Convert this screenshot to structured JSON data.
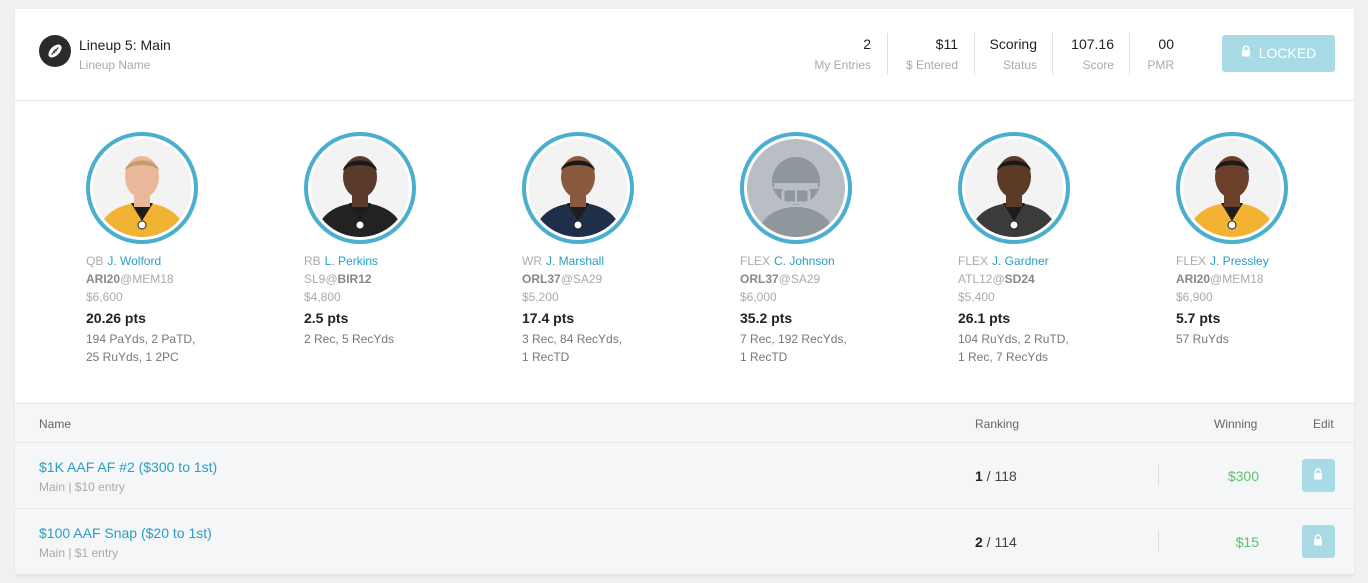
{
  "header": {
    "lineup_title": "Lineup 5: Main",
    "lineup_sub": "Lineup Name",
    "stats": [
      {
        "value": "2",
        "label": "My Entries"
      },
      {
        "value": "$11",
        "label": "$ Entered"
      },
      {
        "value": "Scoring",
        "label": "Status"
      },
      {
        "value": "107.16",
        "label": "Score"
      },
      {
        "value": "00",
        "label": "PMR"
      }
    ],
    "locked_label": "LOCKED"
  },
  "players": [
    {
      "pos": "QB",
      "name": "J. Wolford",
      "team": "ARI20",
      "opp": "MEM18",
      "bold": "team",
      "salary": "$6,600",
      "pts": "20.26 pts",
      "stats1": "194 PaYds, 2 PaTD,",
      "stats2": "25 RuYds, 1 2PC",
      "jersey": "#f2b233",
      "skin": "#e9b89a",
      "hair": "#c89b6a"
    },
    {
      "pos": "RB",
      "name": "L. Perkins",
      "team": "SL9",
      "opp": "BIR12",
      "bold": "opp",
      "salary": "$4,800",
      "pts": "2.5 pts",
      "stats1": "2 Rec, 5 RecYds",
      "stats2": "",
      "jersey": "#222222",
      "skin": "#5a3a2a",
      "hair": "#1a1a1a"
    },
    {
      "pos": "WR",
      "name": "J. Marshall",
      "team": "ORL37",
      "opp": "SA29",
      "bold": "team",
      "salary": "$5,200",
      "pts": "17.4 pts",
      "stats1": "3 Rec, 84 RecYds,",
      "stats2": "1 RecTD",
      "jersey": "#1f2f4a",
      "skin": "#8a5a3e",
      "hair": "#1a1a1a"
    },
    {
      "pos": "FLEX",
      "name": "C. Johnson",
      "team": "ORL37",
      "opp": "SA29",
      "bold": "team",
      "salary": "$6,000",
      "pts": "35.2 pts",
      "stats1": "7 Rec, 192 RecYds,",
      "stats2": "1 RecTD",
      "jersey": "",
      "skin": "",
      "hair": ""
    },
    {
      "pos": "FLEX",
      "name": "J. Gardner",
      "team": "ATL12",
      "opp": "SD24",
      "bold": "opp",
      "salary": "$5,400",
      "pts": "26.1 pts",
      "stats1": "104 RuYds, 2 RuTD,",
      "stats2": "1 Rec, 7 RecYds",
      "jersey": "#3b3b3b",
      "skin": "#5c3a28",
      "hair": "#1a1a1a"
    },
    {
      "pos": "FLEX",
      "name": "J. Pressley",
      "team": "ARI20",
      "opp": "MEM18",
      "bold": "team",
      "salary": "$6,900",
      "pts": "5.7 pts",
      "stats1": "57 RuYds",
      "stats2": "",
      "jersey": "#f2b233",
      "skin": "#6b3f2a",
      "hair": "#1a1a1a"
    }
  ],
  "table": {
    "headers": {
      "name": "Name",
      "ranking": "Ranking",
      "winning": "Winning",
      "edit": "Edit"
    },
    "rows": [
      {
        "title": "$1K AAF AF #2 ($300 to 1st)",
        "sub": "Main | $10 entry",
        "rank": "1",
        "total": "118",
        "win": "$300"
      },
      {
        "title": "$100 AAF Snap ($20 to 1st)",
        "sub": "Main | $1 entry",
        "rank": "2",
        "total": "114",
        "win": "$15"
      }
    ]
  },
  "colors": {
    "accent": "#4aaecf",
    "locked_bg": "#a9dbe7",
    "win_green": "#5cc26a",
    "link": "#2a9ec4"
  },
  "icons": {
    "logo": "football-icon",
    "lock": "lock-icon"
  }
}
